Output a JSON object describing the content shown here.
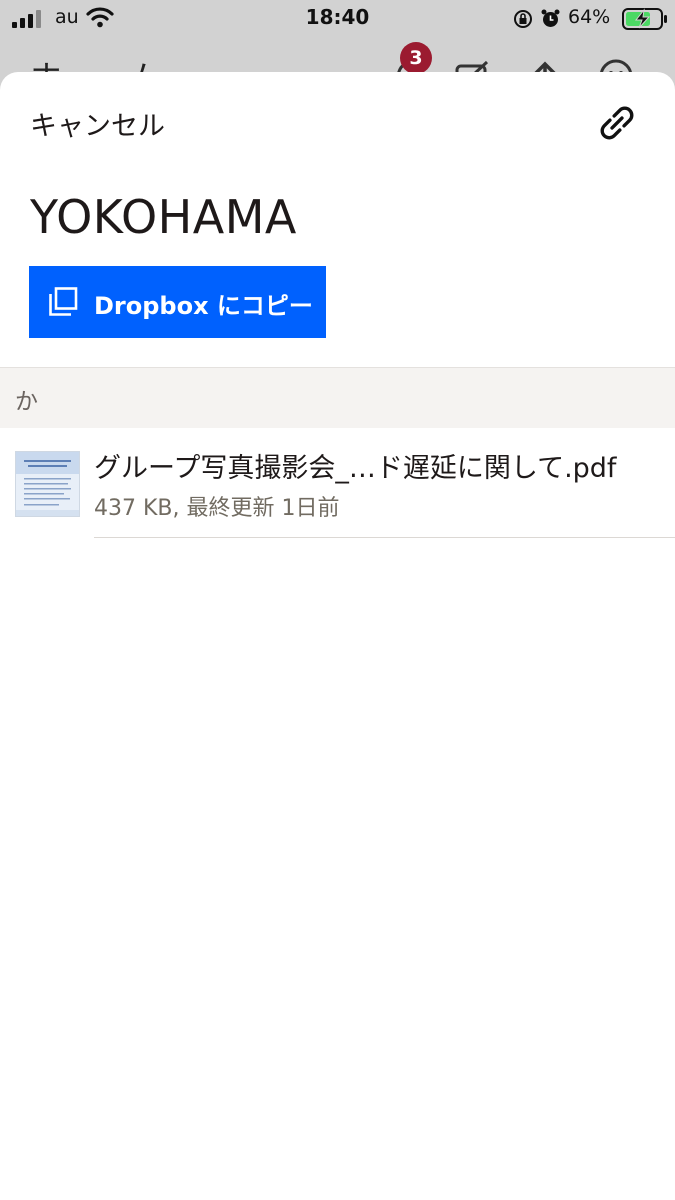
{
  "status_bar": {
    "carrier": "au",
    "time": "18:40",
    "battery_percent": "64%"
  },
  "background_app": {
    "title": "ホーム",
    "notification_count": "3"
  },
  "sheet": {
    "cancel_label": "キャンセル",
    "folder_title": "YOKOHAMA",
    "copy_button_label": "Dropbox にコピー",
    "section_label": "か",
    "files": [
      {
        "name": "グループ写真撮影会_…ド遅延に関して.pdf",
        "meta": "437 KB, 最終更新 1日前"
      }
    ]
  },
  "colors": {
    "accent": "#0061fe",
    "badge": "#9b1b30",
    "section_bg": "#f5f3f1",
    "battery_charging": "#4cd964"
  }
}
